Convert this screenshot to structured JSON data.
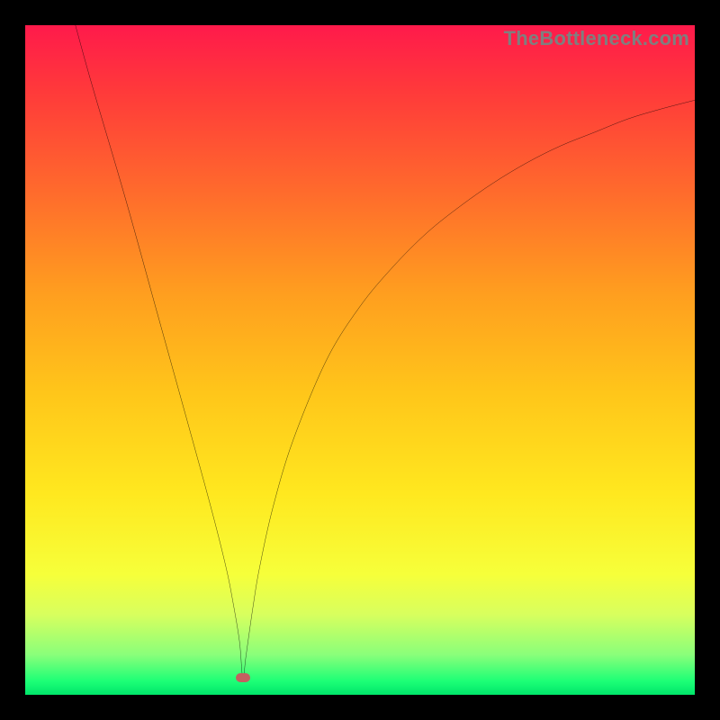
{
  "watermark": "TheBottleneck.com",
  "colors": {
    "frame": "#000000",
    "gradient_top": "#ff1a4b",
    "gradient_bottom": "#00e56a",
    "curve": "#000000",
    "marker": "#c46060",
    "watermark": "#7f7f7f"
  },
  "chart_data": {
    "type": "line",
    "title": "",
    "xlabel": "",
    "ylabel": "",
    "xlim": [
      0,
      100
    ],
    "ylim": [
      0,
      100
    ],
    "grid": false,
    "legend": false,
    "annotations": [
      {
        "type": "marker",
        "x": 32.5,
        "y": 2.5,
        "shape": "rounded-rect",
        "color": "#c46060"
      }
    ],
    "series": [
      {
        "name": "bottleneck-curve",
        "x": [
          7.5,
          10,
          15,
          20,
          25,
          28,
          30,
          31,
          32,
          32.5,
          33,
          34,
          35,
          37,
          40,
          45,
          50,
          55,
          60,
          65,
          70,
          75,
          80,
          85,
          90,
          95,
          100
        ],
        "y": [
          100,
          91,
          74,
          56,
          38,
          27,
          19,
          14,
          8,
          2.5,
          6,
          13,
          19,
          28,
          38,
          50,
          58,
          64,
          69,
          73,
          76.5,
          79.5,
          82,
          84,
          86,
          87.5,
          88.8
        ]
      }
    ]
  }
}
